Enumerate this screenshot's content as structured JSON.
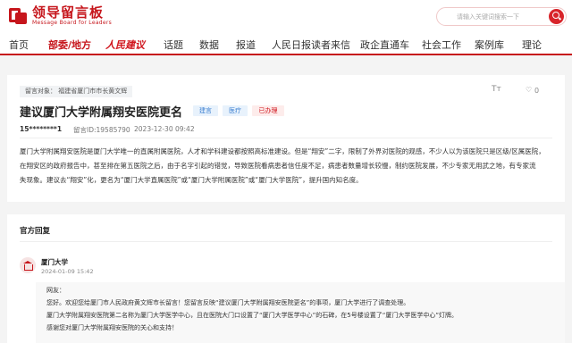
{
  "header": {
    "logo_main": "领导留言板",
    "logo_sub": "Message Board for Leaders",
    "search_placeholder": "请输入关键词",
    "search_hint": "请输入关键词搜索一下"
  },
  "nav": {
    "items": [
      "首页",
      "部委/地方",
      "人民建议",
      "话题",
      "数据",
      "报道",
      "人民日报读者来信",
      "政企直通车",
      "社会工作",
      "案例库",
      "理论"
    ],
    "active_index": 1
  },
  "message": {
    "to_label": "留言对象：  福建省厦门市市长黄文辉",
    "font_icon": "Tт",
    "like_icon": "♡",
    "like_count": "0",
    "title": "建议厦门大学附属翔安医院更名",
    "tags": [
      "建言",
      "医疗",
      "已办理"
    ],
    "user": "15********1",
    "id_label": "留言ID:19585790",
    "time": "2023-12-30 09:42",
    "body_lines": [
      "厦门大学附属翔安医院是厦门大学唯一的直属附属医院，人才和学科建设都按照高标准建设。但是“翔安”二字，限制了外界对医院的观感，不少人以为该医院只是区级/区属医院，",
      "在翔安区的政府报告中，甚至排在第五医院之后，由于名字引起的错觉，导致医院看病患者信任度不足，病患者数量增长较慢，制约医院发展，不少专家无用武之地，有专家流",
      "失现象。建议去“翔安”化，更名为“厦门大学直属医院”或“厦门大学附属医院”或“厦门大学医院”，提升国内知名度。"
    ]
  },
  "reply": {
    "section_title": "官方回复",
    "org_name": "厦门大学",
    "org_time": "2024-01-09 15:42",
    "lines": [
      "网友：",
      "您好。欢迎您给厦门市人民政府黄文辉市长留言！您留言反映“建议厦门大学附属翔安医院更名”的事项，厦门大学进行了调查处理。",
      "厦门大学附属翔安医院第二名称为厦门大学医学中心，且在医院大门口设置了“厦门大学医学中心”的石碑，在5号楼设置了“厦门大学医学中心”灯牌。",
      "感谢您对厦门大学附属翔安医院的关心和支持！"
    ]
  },
  "colors": {
    "brand_red": "#c6161c",
    "tag_blue": "#3b7fd1"
  }
}
